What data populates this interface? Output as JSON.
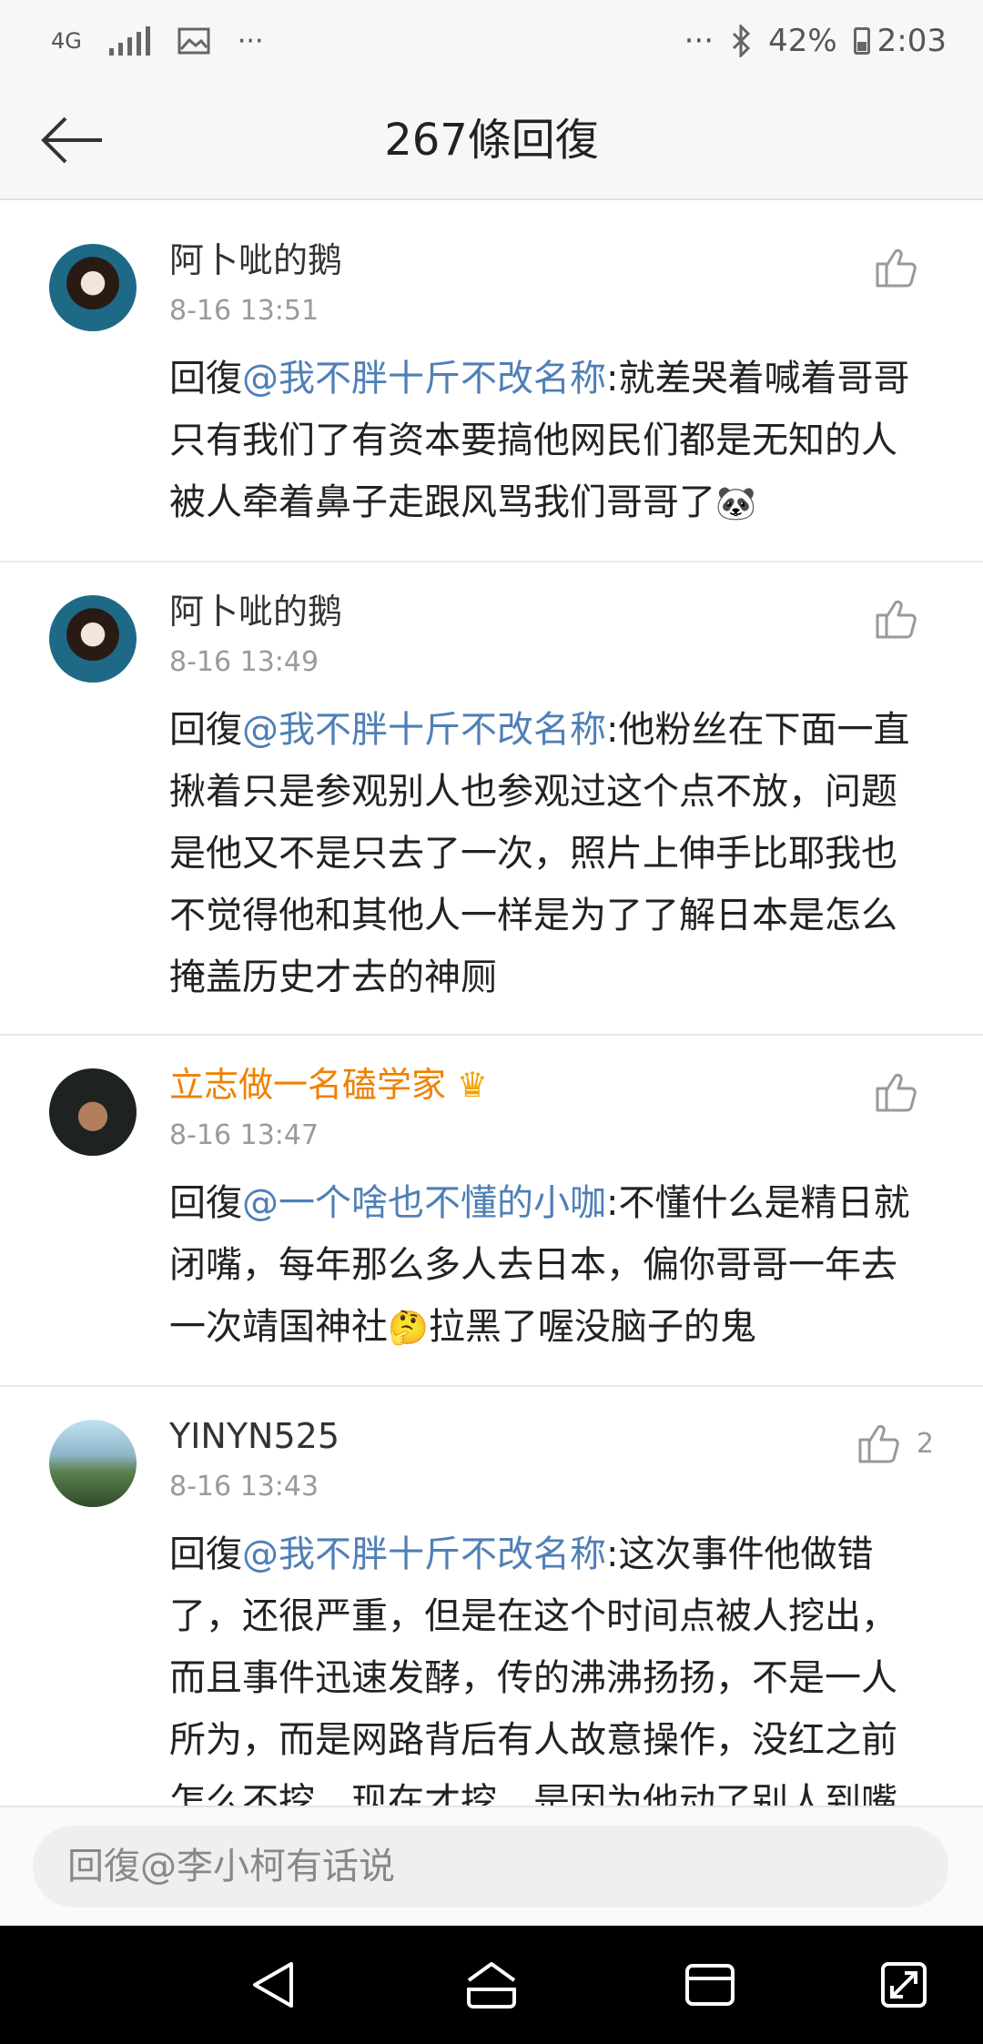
{
  "status_bar": {
    "network": "4G",
    "network_sub": "G",
    "left_more": "···",
    "right_more": "···",
    "battery": "42%",
    "time": "2:03"
  },
  "header": {
    "title": "267條回復"
  },
  "comments": [
    {
      "username": "阿卜呲的鹅",
      "time": "8-16 13:51",
      "prefix": "回復",
      "mention": "@我不胖十斤不改名称",
      "text": ":就差哭着喊着哥哥只有我们了有资本要搞他网民们都是无知的人被人牵着鼻子走跟风骂我们哥哥了",
      "emoji": "🐼",
      "likes": ""
    },
    {
      "username": "阿卜呲的鹅",
      "time": "8-16 13:49",
      "prefix": "回復",
      "mention": "@我不胖十斤不改名称",
      "text": ":他粉丝在下面一直揪着只是参观别人也参观过这个点不放，问题是他又不是只去了一次，照片上伸手比耶我也不觉得他和其他人一样是为了了解日本是怎么掩盖历史才去的神厕",
      "likes": ""
    },
    {
      "username": "立志做一名磕学家",
      "time": "8-16 13:47",
      "prefix": "回復",
      "mention": "@一个啥也不懂的小咖",
      "text_a": ":不懂什么是精日就闭嘴，每年那么多人去日本，偏你哥哥一年去一次靖国神社",
      "emoji": "🤔",
      "text_b": "拉黑了喔没脑子的鬼",
      "likes": ""
    },
    {
      "username": "YINYN525",
      "time": "8-16 13:43",
      "prefix": "回復",
      "mention": "@我不胖十斤不改名称",
      "text": ":这次事件他做错了，还很严重，但是在这个时间点被人挖出，而且事件迅速发酵，传的沸沸扬扬，不是一人所为，而是网路背后有人故意操作，没红之前怎么不挖，现在才挖，是因为他动了别人到嘴",
      "likes": "2"
    }
  ],
  "reply_bar": {
    "placeholder": "回復@李小柯有话说"
  }
}
